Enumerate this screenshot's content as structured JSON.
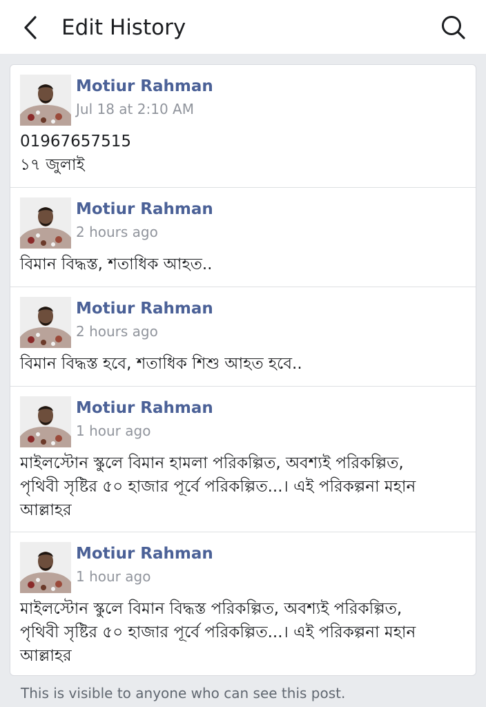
{
  "header": {
    "back_icon": "chevron-left-icon",
    "title": "Edit History",
    "search_icon": "search-icon"
  },
  "entries": [
    {
      "author": "Motiur Rahman",
      "time": "Jul 18 at 2:10 AM",
      "lines": [
        "01967657515",
        "১৭ জুলাই"
      ]
    },
    {
      "author": "Motiur Rahman",
      "time": "2 hours ago",
      "lines": [
        "বিমান বিদ্ধস্ত, শতাধিক আহত.."
      ]
    },
    {
      "author": "Motiur Rahman",
      "time": "2 hours ago",
      "lines": [
        "বিমান বিদ্ধস্ত হবে, শতাধিক শিশু আহত হবে.."
      ]
    },
    {
      "author": "Motiur Rahman",
      "time": "1 hour ago",
      "lines": [
        "মাইলস্টোন স্কুলে বিমান হামলা পরিকল্পিত, অবশ্যই পরিকল্পিত,",
        "পৃথিবী সৃষ্টির ৫০ হাজার পূর্বে পরিকল্পিত...। এই পরিকল্পনা মহান",
        "আল্লাহর"
      ]
    },
    {
      "author": "Motiur Rahman",
      "time": "1 hour ago",
      "lines": [
        "মাইলস্টোন স্কুলে বিমান বিদ্ধস্ত পরিকল্পিত, অবশ্যই পরিকল্পিত,",
        "পৃথিবী সৃষ্টির ৫০ হাজার পূর্বে পরিকল্পিত...। এই পরিকল্পনা মহান",
        "আল্লাহর"
      ]
    }
  ],
  "footer": {
    "note": "This is visible to anyone who can see this post."
  },
  "colors": {
    "author_name": "#4b6197",
    "timestamp": "#90949c",
    "background": "#e9ebee"
  }
}
